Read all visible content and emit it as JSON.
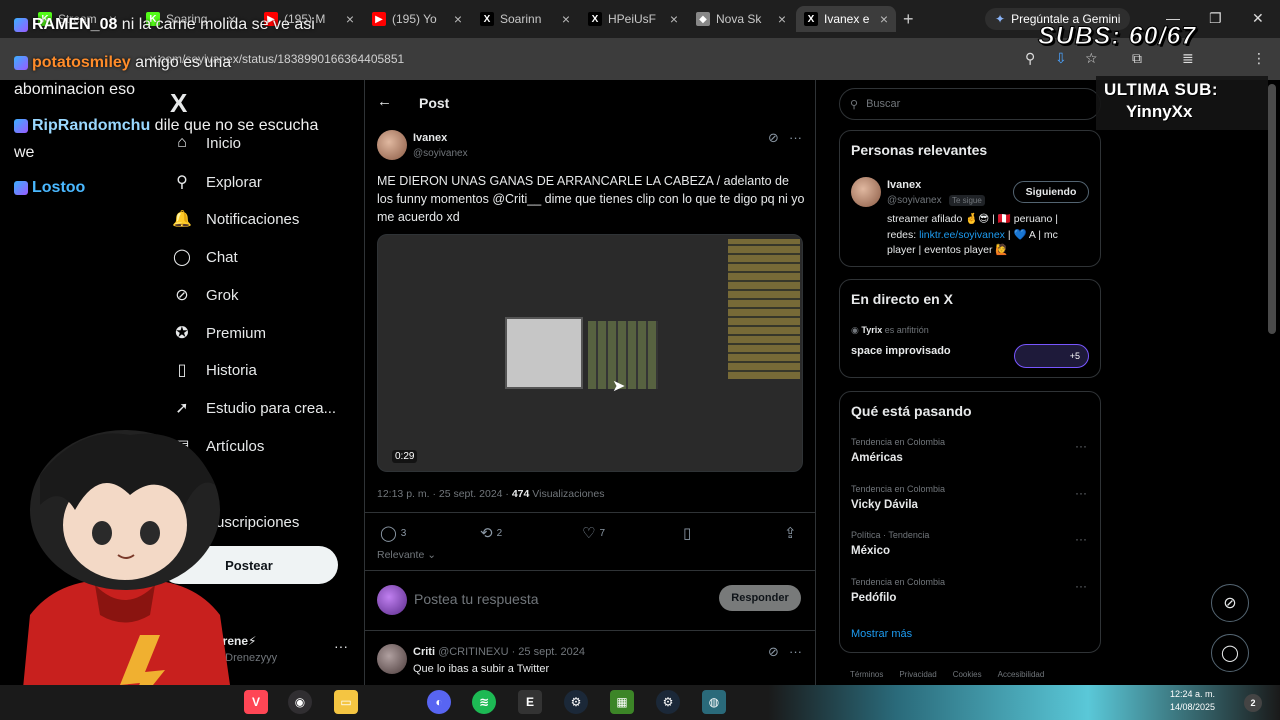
{
  "browser": {
    "tabs": [
      {
        "label": "Stream",
        "icon": "green-k-favicon",
        "color": "#53fc18"
      },
      {
        "label": "Soaring",
        "icon": "green-k-favicon",
        "color": "#53fc18"
      },
      {
        "label": "(195) M",
        "icon": "youtube-favicon",
        "color": "#ff0000"
      },
      {
        "label": "(195) Yo",
        "icon": "youtube-favicon",
        "color": "#ff0000"
      },
      {
        "label": "Soarinn",
        "icon": "x-favicon",
        "color": "#000000"
      },
      {
        "label": "HPeiUsF",
        "icon": "x-favicon",
        "color": "#000000"
      },
      {
        "label": "Nova Sk",
        "icon": "box-favicon",
        "color": "#888888"
      },
      {
        "label": "Ivanex e",
        "icon": "x-favicon",
        "color": "#000000"
      }
    ],
    "gemini_label": "Pregúntale a Gemini",
    "url": "x.com/soyivanex/status/1838990166364405851"
  },
  "x": {
    "nav": [
      {
        "label": "Inicio",
        "icon": "home-icon",
        "glyph": "⌂"
      },
      {
        "label": "Explorar",
        "icon": "search-icon",
        "glyph": "⚲"
      },
      {
        "label": "Notificaciones",
        "icon": "bell-icon",
        "glyph": "🔔"
      },
      {
        "label": "Chat",
        "icon": "chat-icon",
        "glyph": "◯"
      },
      {
        "label": "Grok",
        "icon": "grok-icon",
        "glyph": "⊘"
      },
      {
        "label": "Premium",
        "icon": "verified-icon",
        "glyph": "✪"
      },
      {
        "label": "Historia",
        "icon": "bookmark-icon",
        "glyph": "▯"
      },
      {
        "label": "Estudio para crea...",
        "icon": "rocket-icon",
        "glyph": "➚"
      },
      {
        "label": "Artículos",
        "icon": "article-icon",
        "glyph": "▤"
      },
      {
        "label": "Suscripciones",
        "icon": "subscriptions-icon",
        "glyph": "✦"
      }
    ],
    "post_button": "Postear",
    "account": {
      "name": "Drene⚡",
      "handle": "@Drenezyyy"
    },
    "post_header": "Post",
    "post": {
      "author": "Ivanex",
      "handle": "@soyivanex",
      "text": "ME DIERON UNAS GANAS DE ARRANCARLE LA CABEZA / adelanto de los funny momentos @Criti__ dime que tienes clip con lo que te digo pq ni yo me acuerdo xd",
      "video_duration": "0:29",
      "time": "12:13 p. m. · 25 sept. 2024 · ",
      "views": "474",
      "views_label": " Visualizaciones",
      "replies": "3",
      "reposts": "2",
      "likes": "7"
    },
    "relevance_label": "Relevante",
    "reply_placeholder": "Postea tu respuesta",
    "reply_button": "Responder",
    "reply": {
      "name": "Criti",
      "meta": "@CRITINEXU · 25 sept. 2024",
      "text": "Que lo ibas a subir a Twitter"
    },
    "search_placeholder": "Buscar",
    "relevant_people": {
      "title": "Personas relevantes",
      "name": "Ivanex",
      "handle": "@soyivanex",
      "follows_you": "Te sigue",
      "button": "Siguiendo",
      "bio_1": "streamer afilado 🤞😎 | 🇵🇪 peruano | redes: ",
      "bio_link": "linktr.ee/soyivanex",
      "bio_2": " | 💙 A | mc player | eventos player 🙋"
    },
    "live": {
      "title": "En directo en X",
      "host": "Tyrix",
      "host_suffix": " es anfitrión",
      "space": "space improvisado",
      "listeners": "+5"
    },
    "trends": {
      "title": "Qué está pasando",
      "items": [
        {
          "category": "Tendencia en Colombia",
          "name": "Américas"
        },
        {
          "category": "Tendencia en Colombia",
          "name": "Vicky Dávila"
        },
        {
          "category": "Política · Tendencia",
          "name": "México"
        },
        {
          "category": "Tendencia en Colombia",
          "name": "Pedófilo"
        }
      ],
      "show_more": "Mostrar más"
    },
    "footer": [
      "Términos",
      "Privacidad",
      "Cookies",
      "Accesibilidad"
    ]
  },
  "overlay": {
    "chat": [
      {
        "user": "RAMEN_08",
        "color": "#ffffff",
        "message": " ni la carne molida se ve asi"
      },
      {
        "user": "potatosmiley",
        "color": "#ff8c2a",
        "message": " amigo es una"
      },
      {
        "user": "",
        "color": "#ffffff",
        "message": "abominacion eso"
      },
      {
        "user": "RipRandomchu",
        "color": "#9ad8ff",
        "message": " dile que no se escucha"
      },
      {
        "user": "",
        "color": "#ffffff",
        "message": "we"
      },
      {
        "user": "Lostoo",
        "color": "#4ab8ff",
        "message": ""
      }
    ],
    "subs": "SUBS: 60/67",
    "last_sub_label": "ULTIMA SUB:",
    "last_sub_name": "YinnyXx"
  },
  "taskbar": {
    "time": "12:24 a. m.",
    "date": "14/08/2025",
    "notifications": "2",
    "apps": [
      "valorant-icon",
      "obs-icon",
      "folder-icon",
      "discord-icon",
      "spotify-icon",
      "epic-games-icon",
      "steam-icon",
      "minecraft-icon",
      "steam-icon",
      "browser-icon"
    ]
  }
}
